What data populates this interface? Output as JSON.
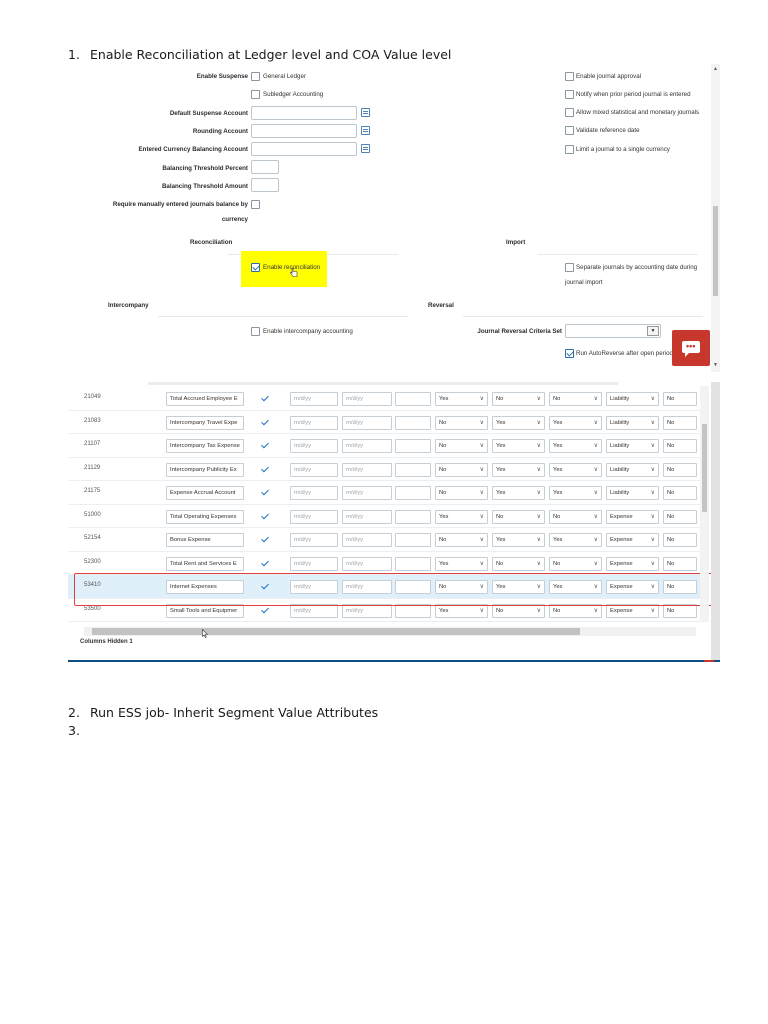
{
  "steps": [
    {
      "num": "1.",
      "text": "Enable Reconciliation at Ledger level and COA Value level"
    },
    {
      "num": "2.",
      "text": "Run ESS job-  Inherit Segment Value Attributes"
    },
    {
      "num": "3.",
      "text": ""
    }
  ],
  "ledger_form": {
    "enable_suspense_label": "Enable Suspense",
    "general_ledger": "General Ledger",
    "subledger_accounting": "Subledger Accounting",
    "default_suspense_account": "Default Suspense Account",
    "rounding_account": "Rounding Account",
    "entered_currency_balancing_account": "Entered Currency Balancing Account",
    "balancing_threshold_percent": "Balancing Threshold Percent",
    "balancing_threshold_amount": "Balancing Threshold Amount",
    "require_balance_line1": "Require manually entered journals balance by",
    "require_balance_line2": "currency",
    "right_options": [
      "Enable journal approval",
      "Notify when prior period journal is entered",
      "Allow mixed statistical and monetary journals",
      "Validate reference date",
      "Limit a journal to a single currency"
    ],
    "reconciliation_header": "Reconciliation",
    "enable_reconciliation": "Enable reconciliation",
    "import_header": "Import",
    "separate_journals_line1": "Separate journals by accounting date during",
    "separate_journals_line2": "journal import",
    "intercompany_header": "Intercompany",
    "enable_intercompany": "Enable intercompany accounting",
    "reversal_header": "Reversal",
    "journal_reversal_criteria": "Journal Reversal Criteria Set",
    "run_autoreverse": "Run AutoReverse after open period"
  },
  "values_table": {
    "date_placeholder": "m/d/yy",
    "rows": [
      {
        "code": "21049",
        "desc": "Total Accrued Employee E",
        "d1": "Yes",
        "d2": "No",
        "d3": "No",
        "type": "Liability",
        "last": "No"
      },
      {
        "code": "21083",
        "desc": "Intercompany Travel Expe",
        "d1": "No",
        "d2": "Yes",
        "d3": "Yes",
        "type": "Liability",
        "last": "No"
      },
      {
        "code": "21107",
        "desc": "Intercompany Tax Expense",
        "d1": "No",
        "d2": "Yes",
        "d3": "Yes",
        "type": "Liability",
        "last": "No"
      },
      {
        "code": "21129",
        "desc": "Intercompany Publicity Ex",
        "d1": "No",
        "d2": "Yes",
        "d3": "Yes",
        "type": "Liability",
        "last": "No"
      },
      {
        "code": "21175",
        "desc": "Expense Accrual Account",
        "d1": "No",
        "d2": "Yes",
        "d3": "Yes",
        "type": "Liability",
        "last": "No"
      },
      {
        "code": "51000",
        "desc": "Total Operating Expenses",
        "d1": "Yes",
        "d2": "No",
        "d3": "No",
        "type": "Expense",
        "last": "No"
      },
      {
        "code": "52154",
        "desc": "Bonus Expense",
        "d1": "No",
        "d2": "Yes",
        "d3": "Yes",
        "type": "Expense",
        "last": "No"
      },
      {
        "code": "52300",
        "desc": "Total Rent and Services E",
        "d1": "Yes",
        "d2": "No",
        "d3": "No",
        "type": "Expense",
        "last": "No"
      },
      {
        "code": "53410",
        "desc": "Internet Expenses",
        "d1": "No",
        "d2": "Yes",
        "d3": "Yes",
        "type": "Expense",
        "last": "No"
      },
      {
        "code": "53500",
        "desc": "Small Tools and Equipmer",
        "d1": "Yes",
        "d2": "No",
        "d3": "No",
        "type": "Expense",
        "last": "No"
      }
    ],
    "columns_hidden": "Columns Hidden  1"
  },
  "colors": {
    "highlight": "#ffff00",
    "selected_row": "#dff0fb",
    "red_outline": "#e04040",
    "chat_button": "#c7372c"
  }
}
